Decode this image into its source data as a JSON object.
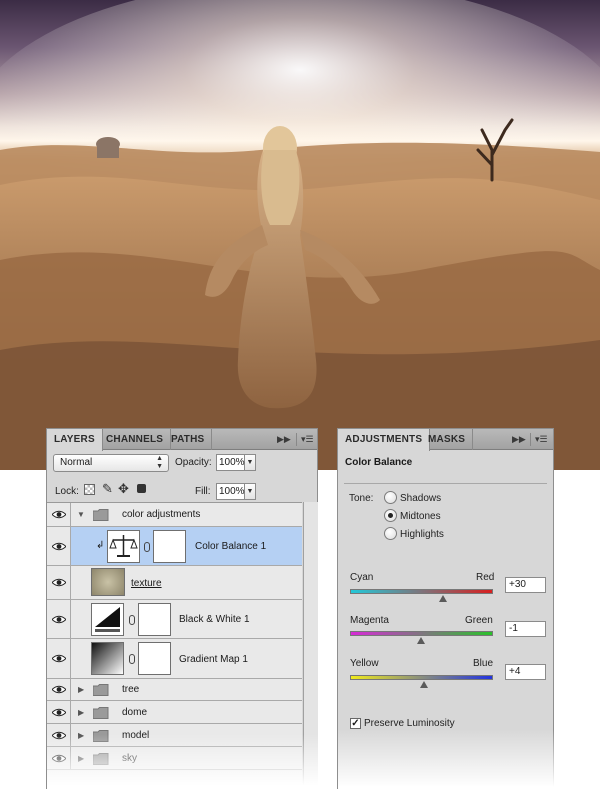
{
  "layers_panel": {
    "tabs": [
      "LAYERS",
      "CHANNELS",
      "PATHS"
    ],
    "blend_mode": "Normal",
    "opacity_label": "Opacity:",
    "opacity_value": "100%",
    "lock_label": "Lock:",
    "fill_label": "Fill:",
    "fill_value": "100%",
    "layers": [
      {
        "name": "color adjustments",
        "kind": "group",
        "expanded": true
      },
      {
        "name": "Color Balance 1",
        "kind": "adjustment",
        "selected": true
      },
      {
        "name": "texture",
        "kind": "pixel"
      },
      {
        "name": "Black & White 1",
        "kind": "adjustment"
      },
      {
        "name": "Gradient Map 1",
        "kind": "adjustment"
      },
      {
        "name": "tree",
        "kind": "group",
        "expanded": false
      },
      {
        "name": "dome",
        "kind": "group",
        "expanded": false
      },
      {
        "name": "model",
        "kind": "group",
        "expanded": false
      },
      {
        "name": "sky",
        "kind": "group",
        "expanded": false
      }
    ]
  },
  "adjustments_panel": {
    "tabs": [
      "ADJUSTMENTS",
      "MASKS"
    ],
    "title": "Color Balance",
    "tone_label": "Tone:",
    "tones": [
      "Shadows",
      "Midtones",
      "Highlights"
    ],
    "selected_tone": "Midtones",
    "sliders": [
      {
        "left": "Cyan",
        "right": "Red",
        "value": "+30",
        "level": 30,
        "gradient": [
          "#23c8d8",
          "#d81f1f"
        ]
      },
      {
        "left": "Magenta",
        "right": "Green",
        "value": "-1",
        "level": -1,
        "gradient": [
          "#d62ad6",
          "#29c12a"
        ]
      },
      {
        "left": "Yellow",
        "right": "Blue",
        "value": "+4",
        "level": 4,
        "gradient": [
          "#f0ea1c",
          "#2233e0"
        ]
      }
    ],
    "preserve_luminosity": "Preserve Luminosity",
    "preserve_checked": true
  },
  "icons": {
    "panel_menu": "panel-menu-icon",
    "collapse": "double-arrow-icon",
    "eye": "eye-icon",
    "folder": "folder-icon",
    "balance": "balance-scale-icon"
  }
}
